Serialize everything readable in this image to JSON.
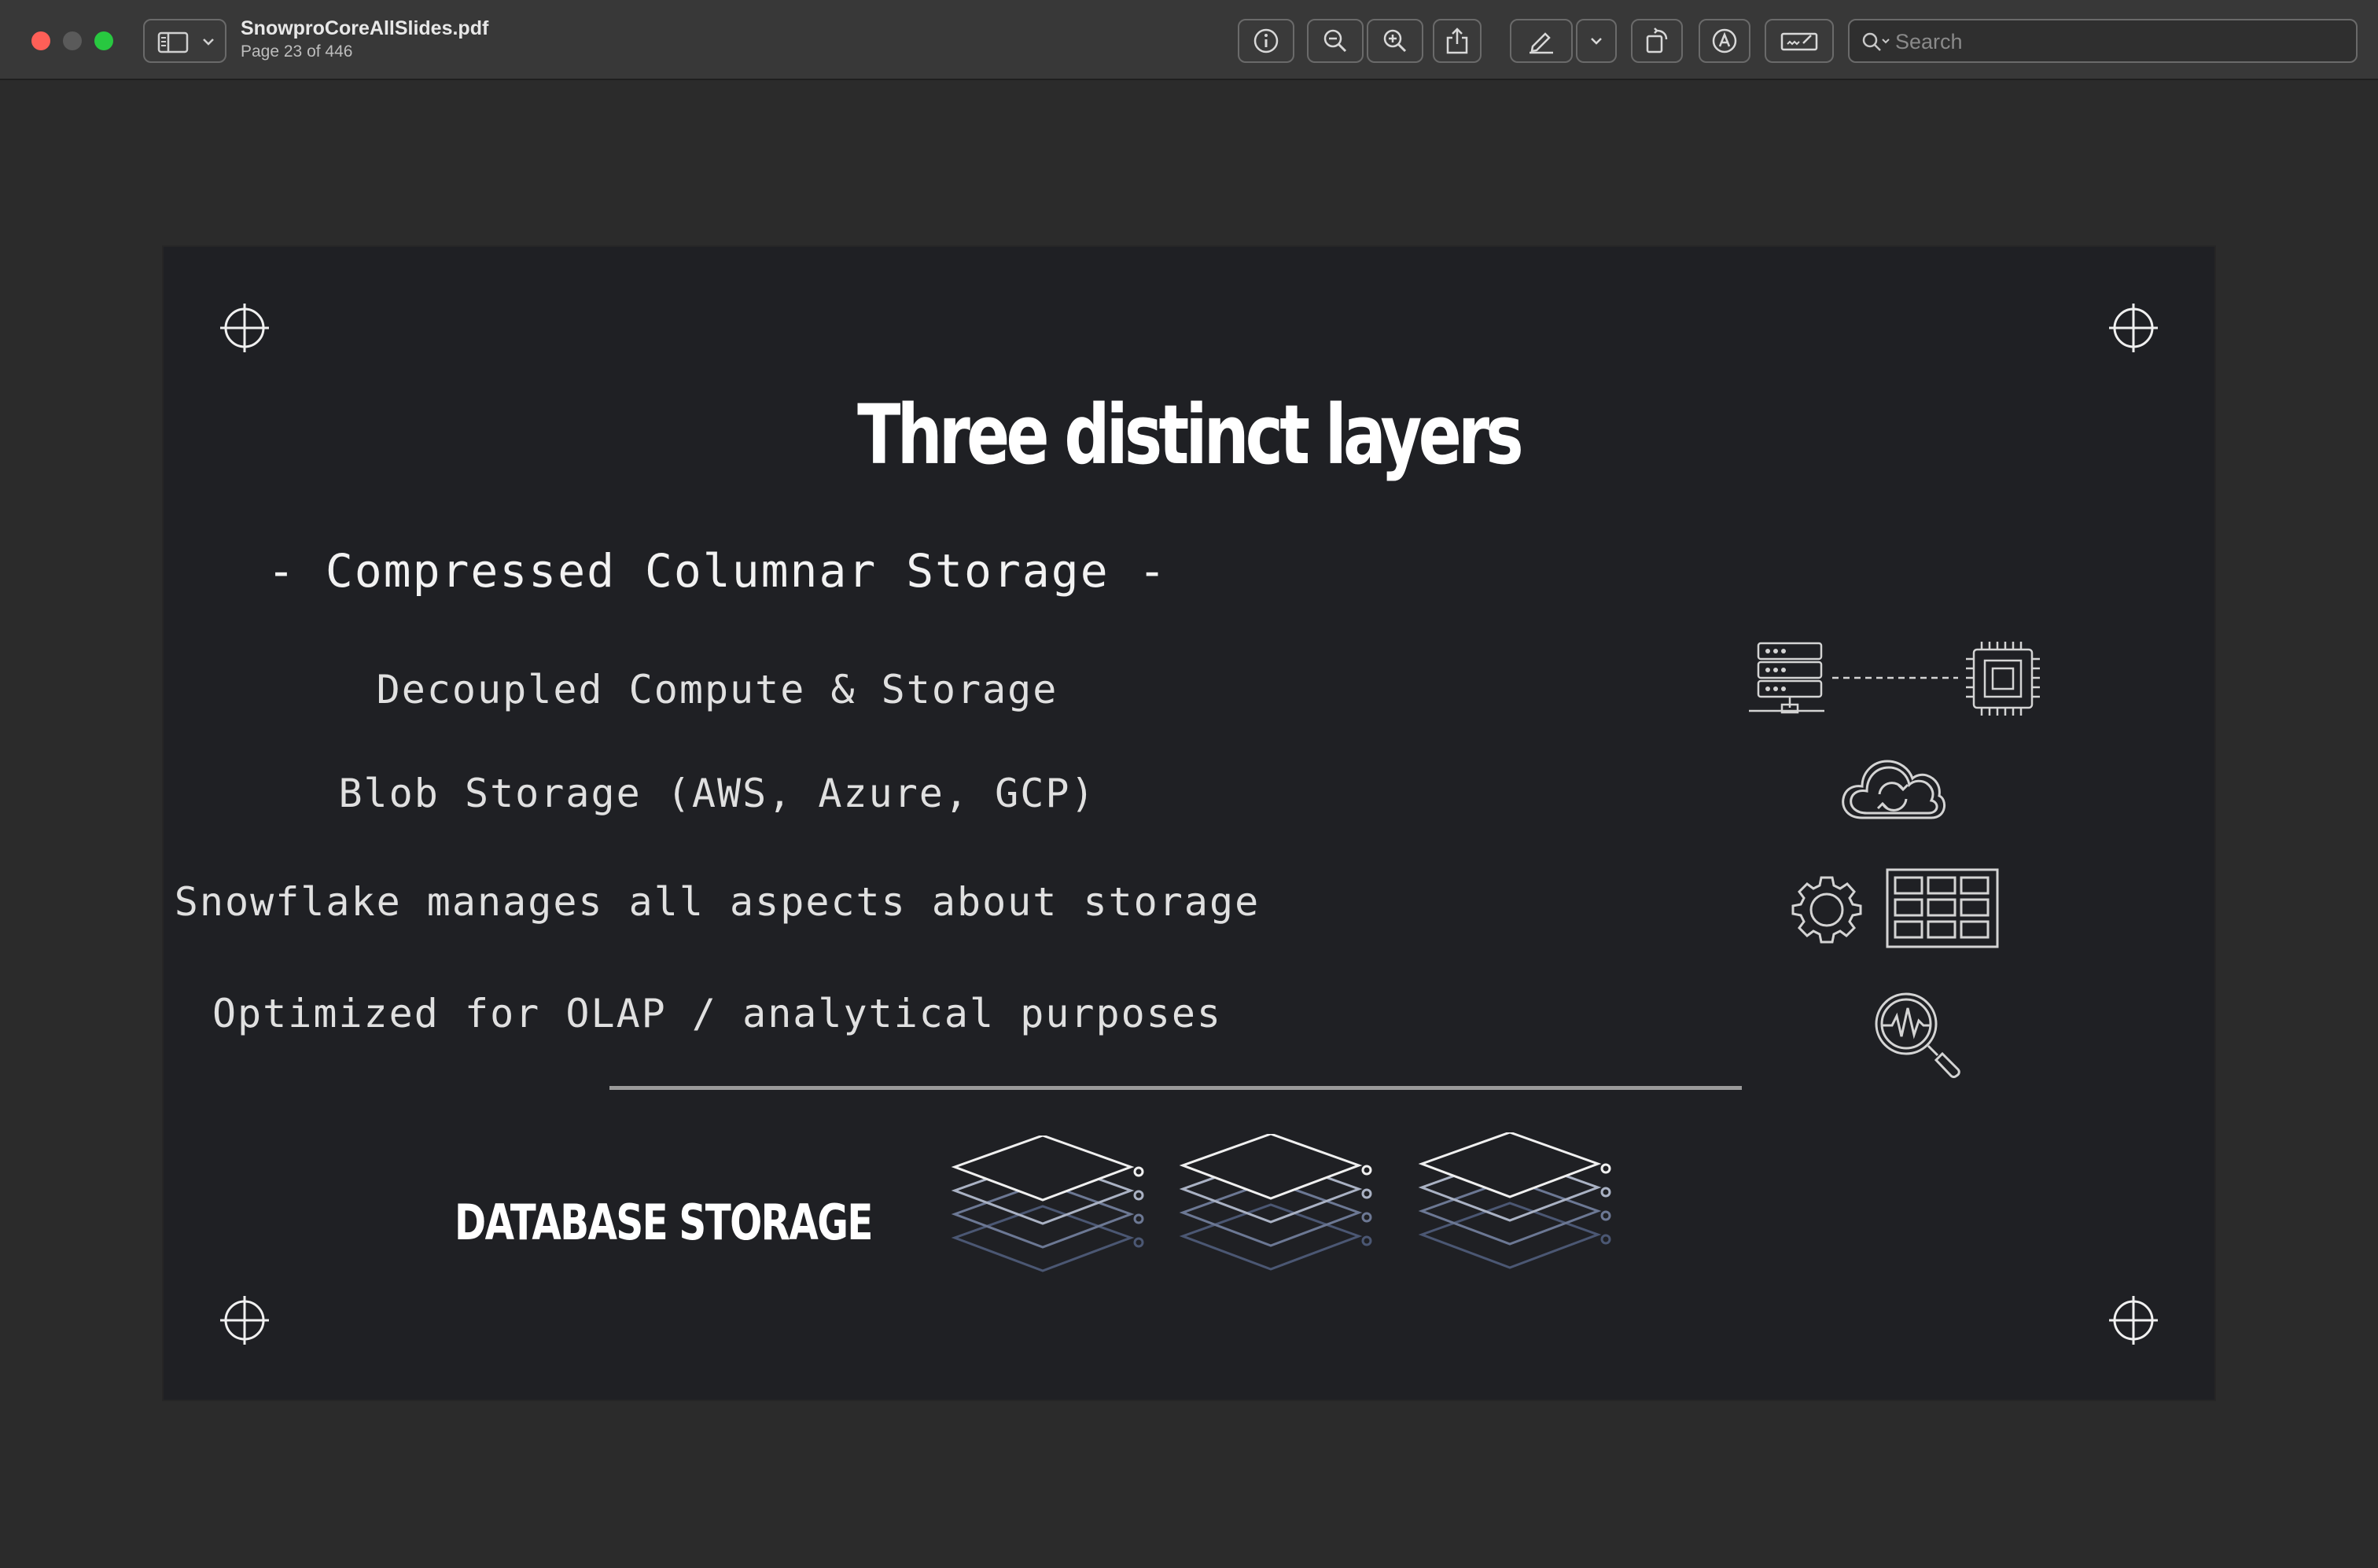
{
  "window": {
    "title": "SnowproCoreAllSlides.pdf",
    "page_status": "Page 23 of 446"
  },
  "toolbar": {
    "buttons": [
      "info-icon",
      "zoom-out-icon",
      "zoom-in-icon",
      "share-icon",
      "markup-pen-icon",
      "chevron-down-icon",
      "rotate-icon",
      "annotate-icon",
      "signature-icon"
    ],
    "search_placeholder": "Search"
  },
  "slide": {
    "title": "Three distinct layers",
    "subtitle": "- Compressed Columnar Storage -",
    "bullets": [
      "Decoupled Compute & Storage",
      "Blob Storage (AWS, Azure, GCP)",
      "Snowflake manages all aspects about storage",
      "Optimized for OLAP / analytical purposes"
    ],
    "section_label": "DATABASE STORAGE",
    "icons": [
      "server-to-chip-icon",
      "cloud-sync-icon",
      "gear-icon",
      "table-grid-icon",
      "analytics-magnifier-icon",
      "layer-stack-icon"
    ]
  }
}
